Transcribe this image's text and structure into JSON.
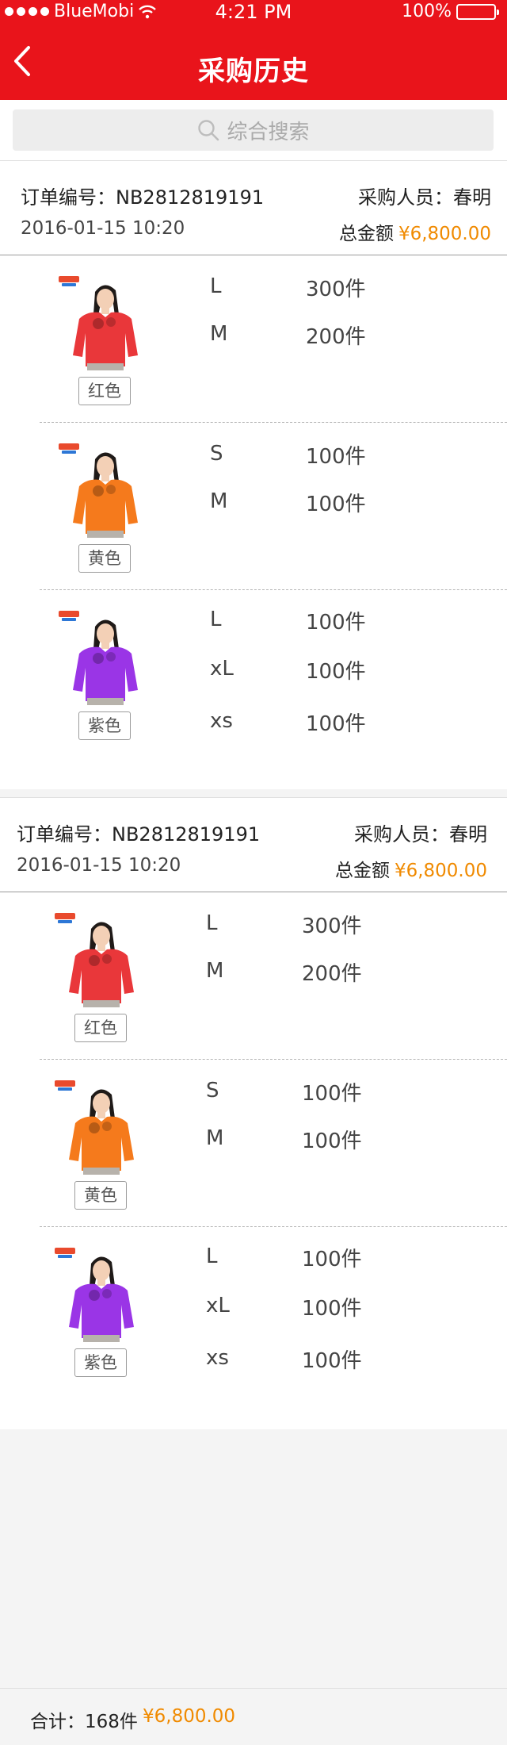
{
  "status_bar": {
    "carrier": "BlueMobi",
    "time": "4:21 PM",
    "battery": "100%",
    "battery_level": 1.0,
    "signal_bars": 4
  },
  "navbar": {
    "title": "采购历史",
    "back_icon": "chevron-left-icon"
  },
  "search": {
    "placeholder": "综合搜索",
    "icon": "search-icon"
  },
  "labels": {
    "order_no_prefix": "订单编号：",
    "buyer_prefix": "采购人员：",
    "total_prefix": "总金额",
    "footer_total_prefix": "合计：",
    "unit": "件"
  },
  "orders": [
    {
      "order_no": "NB2812819191",
      "time": "2016-01-15  10:20",
      "buyer": "春明",
      "total": "¥6,800.00",
      "items": [
        {
          "color": "红色",
          "shirt_hex": "#e9373a",
          "sizes": [
            {
              "size": "L",
              "qty": "300件"
            },
            {
              "size": "M",
              "qty": "200件"
            }
          ]
        },
        {
          "color": "黄色",
          "shirt_hex": "#f57a1c",
          "sizes": [
            {
              "size": "S",
              "qty": "100件"
            },
            {
              "size": "M",
              "qty": "100件"
            }
          ]
        },
        {
          "color": "紫色",
          "shirt_hex": "#9a35e6",
          "sizes": [
            {
              "size": "L",
              "qty": "100件"
            },
            {
              "size": "xL",
              "qty": "100件"
            },
            {
              "size": "xs",
              "qty": "100件"
            }
          ]
        }
      ]
    },
    {
      "order_no": "NB2812819191",
      "time": "2016-01-15  10:20",
      "buyer": "春明",
      "total": "¥6,800.00",
      "items": [
        {
          "color": "红色",
          "shirt_hex": "#e9373a",
          "sizes": [
            {
              "size": "L",
              "qty": "300件"
            },
            {
              "size": "M",
              "qty": "200件"
            }
          ]
        },
        {
          "color": "黄色",
          "shirt_hex": "#f57a1c",
          "sizes": [
            {
              "size": "S",
              "qty": "100件"
            },
            {
              "size": "M",
              "qty": "100件"
            }
          ]
        },
        {
          "color": "紫色",
          "shirt_hex": "#9a35e6",
          "sizes": [
            {
              "size": "L",
              "qty": "100件"
            },
            {
              "size": "xL",
              "qty": "100件"
            },
            {
              "size": "xs",
              "qty": "100件"
            }
          ]
        }
      ]
    }
  ],
  "footer": {
    "total_count": "168件",
    "total_amount": "¥6,800.00"
  },
  "colors": {
    "brand_red": "#e9141b",
    "price_orange": "#f08a00"
  }
}
